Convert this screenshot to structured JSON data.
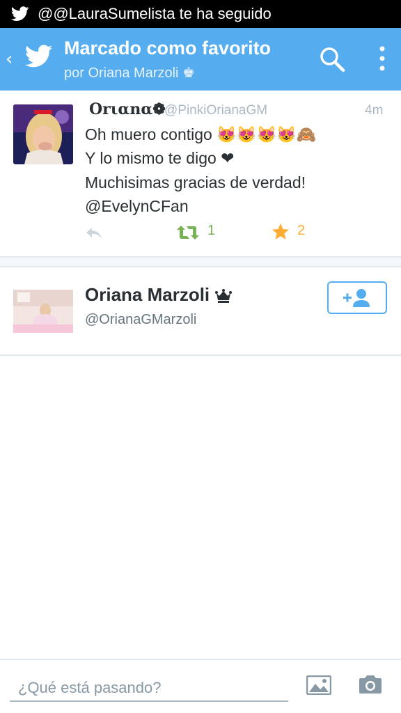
{
  "status_bar": {
    "notification_text": "@@LauraSumelista te ha seguido",
    "icon": "twitter-bird-icon"
  },
  "header": {
    "title": "Marcado como favorito",
    "subtitle": "por Oriana Marzoli ♚",
    "back_icon": "chevron-left-icon",
    "logo_icon": "twitter-bird-icon",
    "search_icon": "search-icon",
    "menu_icon": "overflow-menu-icon",
    "color": "#55acee"
  },
  "tweet": {
    "display_name": "Orιαnα❁",
    "handle": "@PinkiOrianaGM",
    "time": "4m",
    "lines": [
      "Oh muero contigo 😻😻😻😻🙈",
      "Y lo mismo te digo ❤",
      "Muchisimas gracias de verdad!",
      "@EvelynCFan"
    ],
    "retweet_count": "1",
    "favorite_count": "2",
    "retweet_color": "#77b255",
    "favorite_color": "#ffac33"
  },
  "user": {
    "name": "Oriana Marzoli",
    "handle": "@OrianaGMarzoli",
    "follow_icon": "add-user-icon"
  },
  "compose": {
    "placeholder": "¿Qué está pasando?",
    "photo_icon": "image-icon",
    "camera_icon": "camera-icon"
  }
}
